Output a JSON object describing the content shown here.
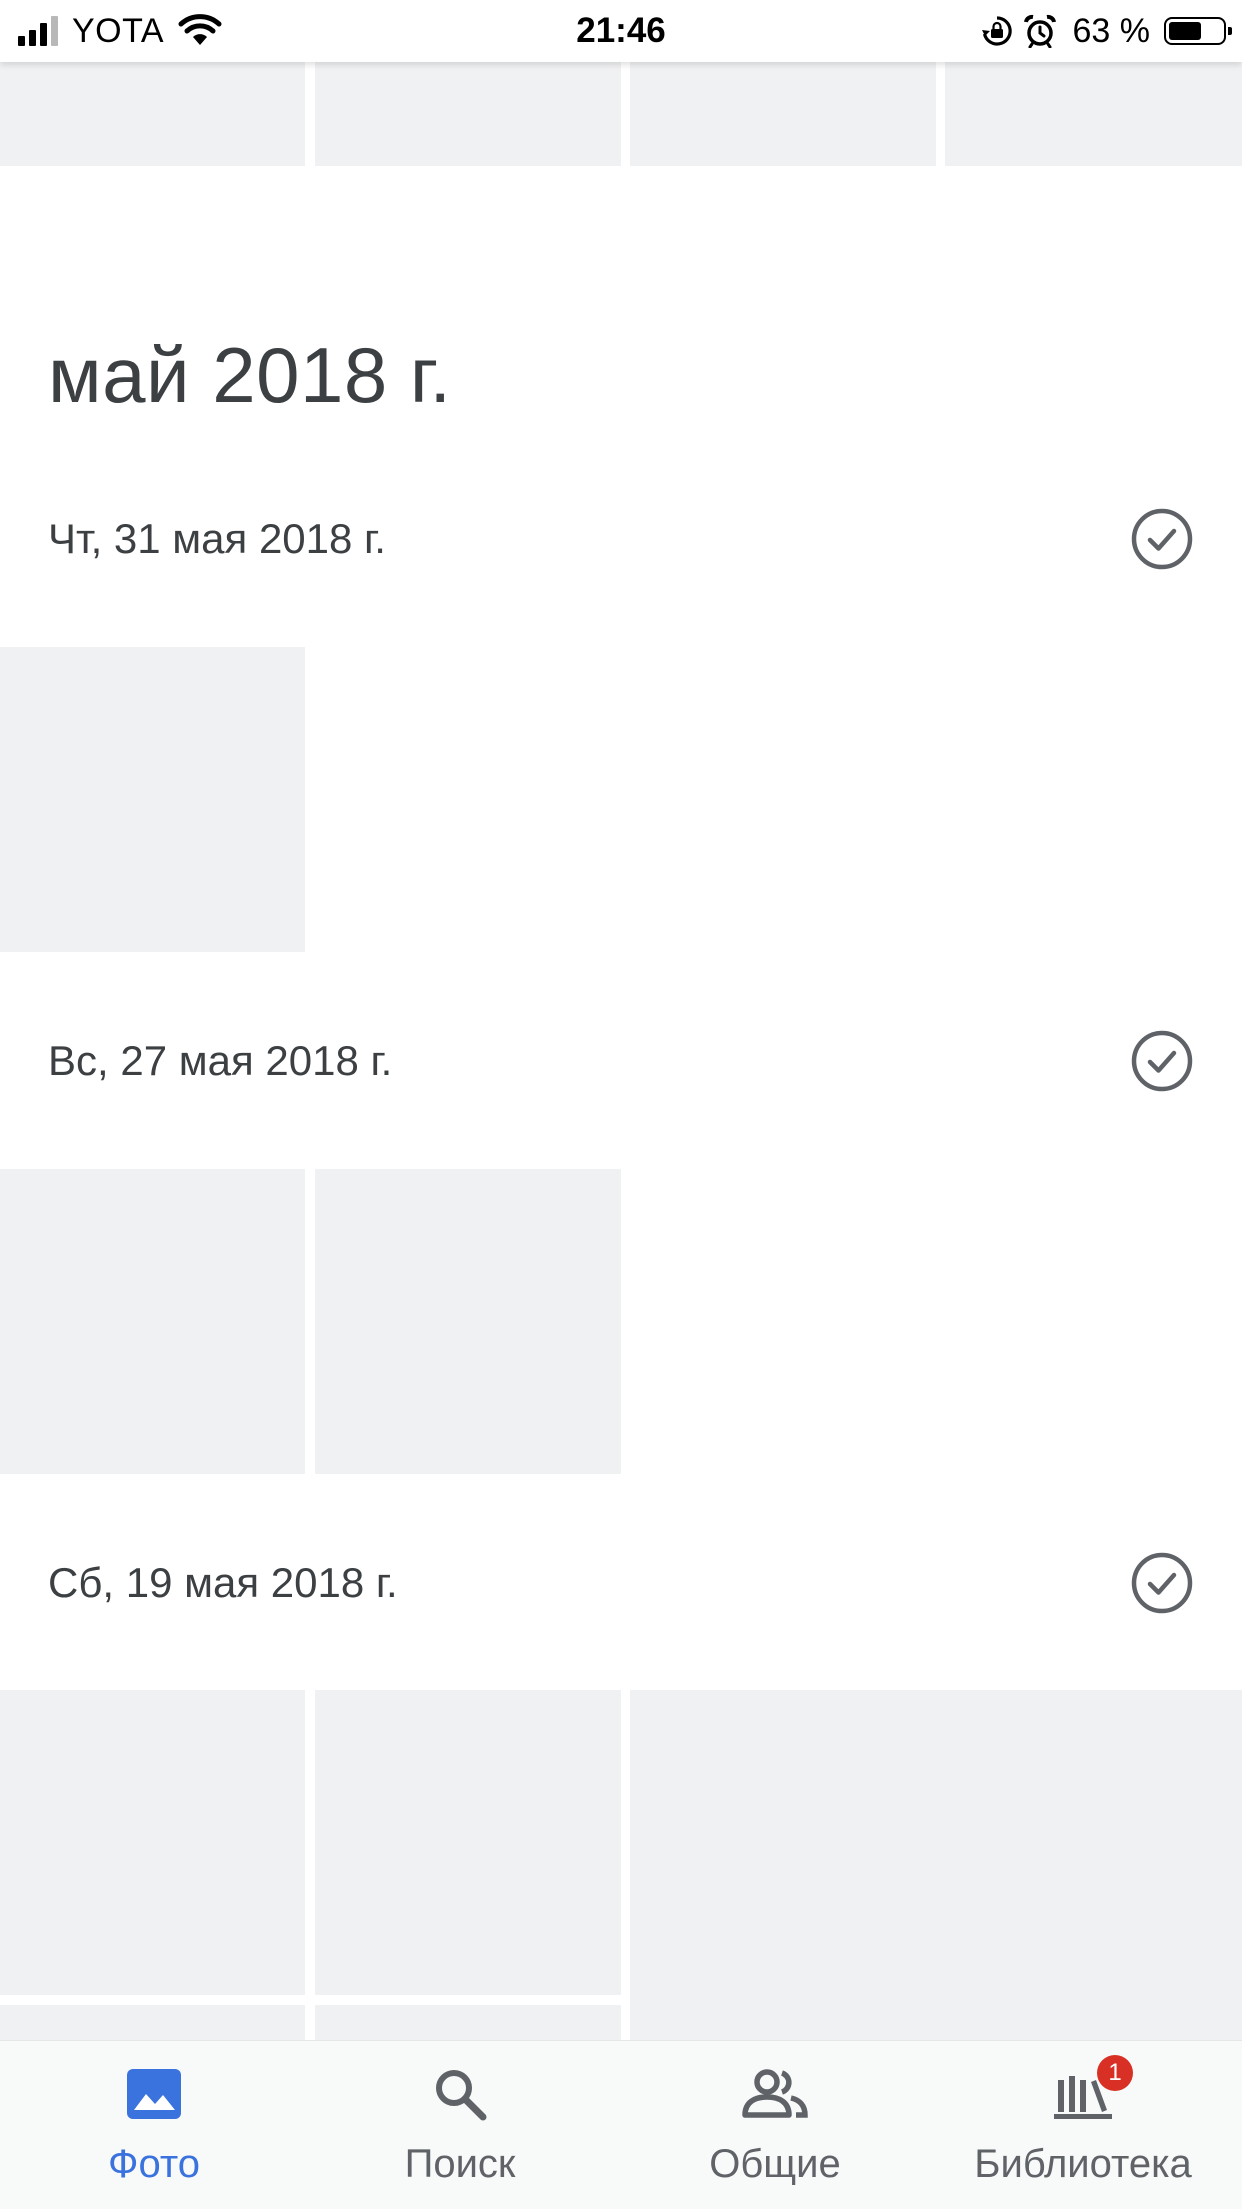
{
  "status_bar": {
    "carrier": "YOTA",
    "time": "21:46",
    "battery_percent": "63 %",
    "battery_level": 0.63
  },
  "month": {
    "title": "май 2018 г."
  },
  "days": [
    {
      "date": "Чт, 31 мая 2018 г.",
      "select_icon": "check-circle-icon"
    },
    {
      "date": "Вс, 27 мая 2018 г.",
      "select_icon": "check-circle-icon"
    },
    {
      "date": "Сб, 19 мая 2018 г.",
      "select_icon": "check-circle-icon"
    }
  ],
  "bottom_nav": {
    "items": [
      {
        "label": "Фото",
        "icon": "photo-icon",
        "active": true
      },
      {
        "label": "Поиск",
        "icon": "search-icon",
        "active": false
      },
      {
        "label": "Общие",
        "icon": "people-icon",
        "active": false
      },
      {
        "label": "Библиотека",
        "icon": "library-icon",
        "active": false,
        "badge": "1"
      }
    ]
  },
  "colors": {
    "accent": "#3a72de",
    "placeholder_tile": "#f0f1f3",
    "text": "#3c4043",
    "badge": "#d93025"
  }
}
